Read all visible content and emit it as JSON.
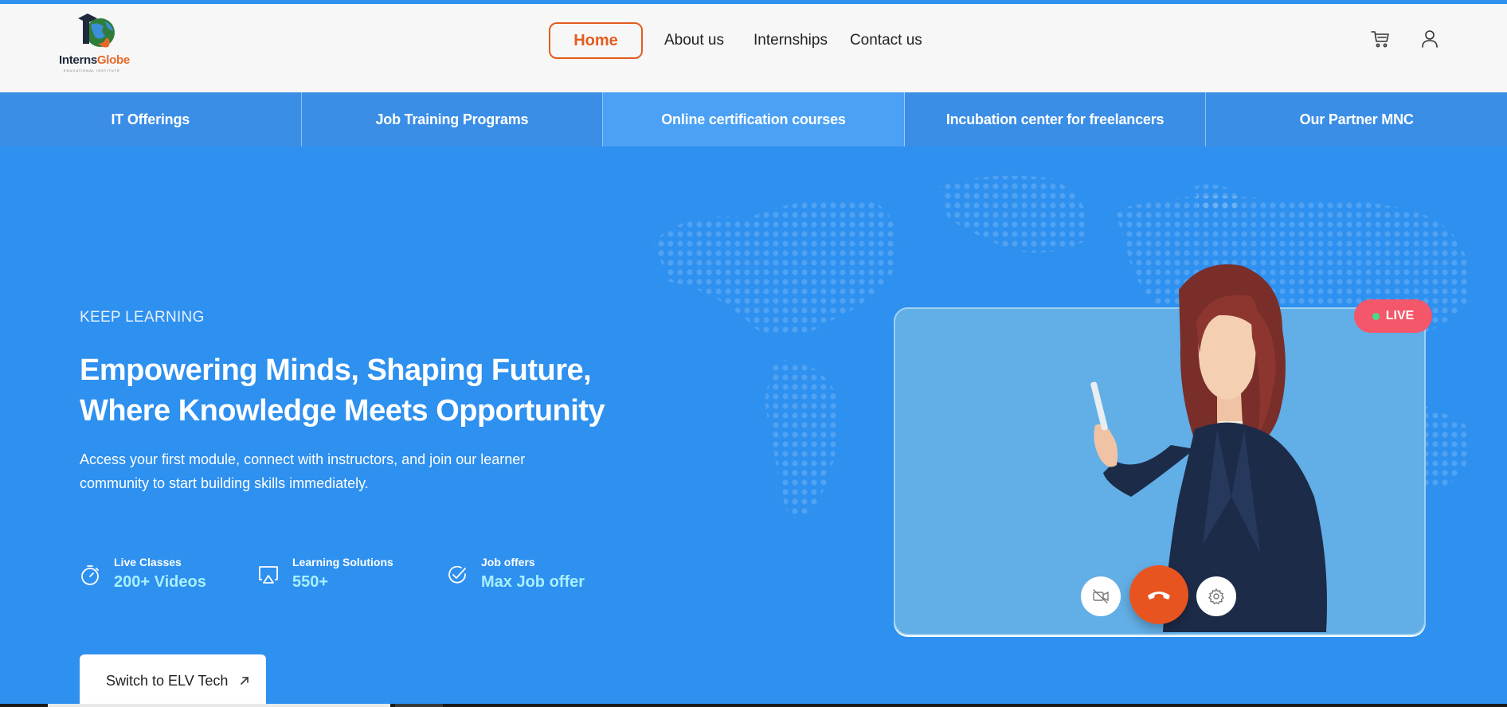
{
  "brand": {
    "name_part1": "Interns",
    "name_part2": "Globe",
    "tagline": "EDUCATIONAL INSTITUTE"
  },
  "nav": {
    "home": "Home",
    "about": "About us",
    "internships": "Internships",
    "contact": "Contact us"
  },
  "categories": [
    {
      "label": "IT Offerings"
    },
    {
      "label": "Job Training Programs"
    },
    {
      "label": "Online certification courses"
    },
    {
      "label": "Incubation center for freelancers"
    },
    {
      "label": "Our Partner MNC"
    }
  ],
  "hero": {
    "kicker": "KEEP LEARNING",
    "headline_line1": "Empowering Minds, Shaping Future,",
    "headline_line2": "Where Knowledge Meets Opportunity",
    "description": "Access your first module, connect with instructors, and join our learner community to start building skills immediately.",
    "stats": [
      {
        "label": "Live Classes",
        "value": "200+ Videos",
        "icon": "stopwatch-icon"
      },
      {
        "label": "Learning Solutions",
        "value": "550+",
        "icon": "screen-cast-icon"
      },
      {
        "label": "Job offers",
        "value": "Max Job offer",
        "icon": "check-circle-icon"
      }
    ],
    "cta": "Switch to ELV Tech"
  },
  "video": {
    "live_badge": "LIVE"
  },
  "colors": {
    "accent": "#e35d1e",
    "hero_bg": "#2e90ef",
    "stat_value": "#a8f0ff",
    "live": "#f4566a"
  }
}
